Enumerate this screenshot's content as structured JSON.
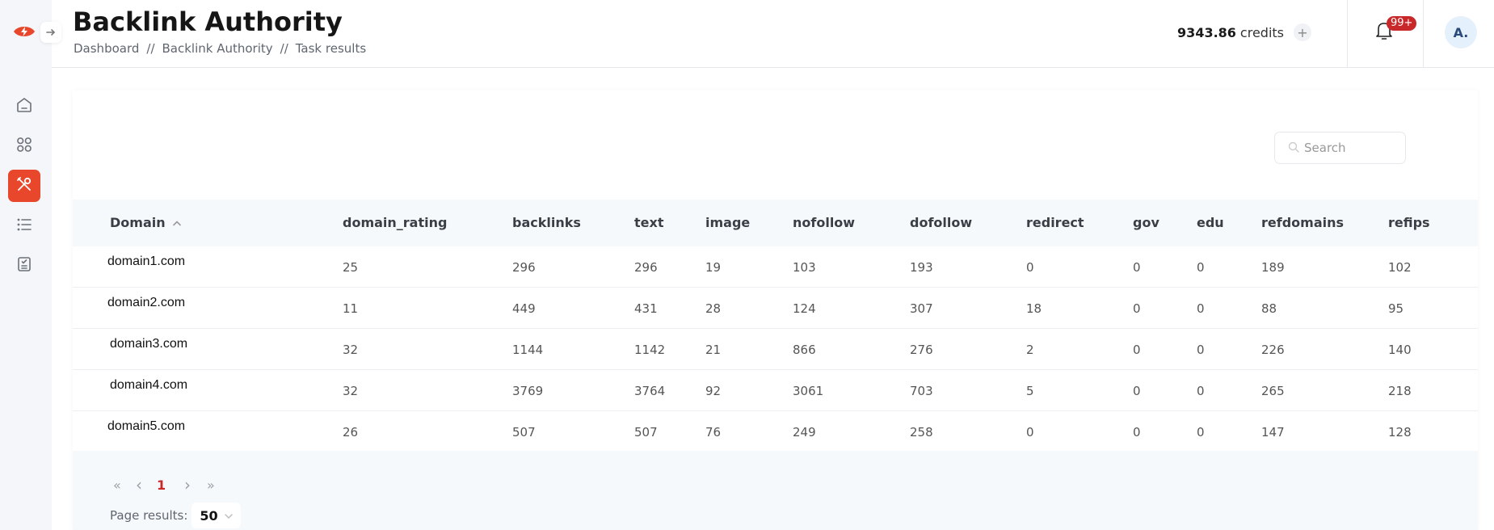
{
  "app": {
    "title": "Backlink Authority",
    "breadcrumb": [
      "Dashboard",
      "Backlink Authority",
      "Task results"
    ],
    "breadcrumb_separator": "//",
    "brand_color": "#e8472b"
  },
  "header": {
    "credits_value": "9343.86",
    "credits_label": "credits",
    "add_credits_label": "+",
    "notifications_badge": "99+",
    "avatar_initials": "A."
  },
  "sidebar": {
    "items": [
      {
        "name": "home",
        "icon": "home-icon",
        "active": false
      },
      {
        "name": "apps",
        "icon": "grid-icon",
        "active": false
      },
      {
        "name": "tools",
        "icon": "tools-icon",
        "active": true
      },
      {
        "name": "list",
        "icon": "list-icon",
        "active": false
      },
      {
        "name": "tasks",
        "icon": "checklist-icon",
        "active": false
      }
    ]
  },
  "search": {
    "placeholder": "Search",
    "value": ""
  },
  "table": {
    "columns": [
      "Domain",
      "domain_rating",
      "backlinks",
      "text",
      "image",
      "nofollow",
      "dofollow",
      "redirect",
      "gov",
      "edu",
      "refdomains",
      "refips"
    ],
    "sort": {
      "column": "Domain",
      "direction": "ascending"
    },
    "rows": [
      [
        "domain1.com",
        "25",
        "296",
        "296",
        "19",
        "103",
        "193",
        "0",
        "0",
        "0",
        "189",
        "102"
      ],
      [
        "domain2.com",
        "11",
        "449",
        "431",
        "28",
        "124",
        "307",
        "18",
        "0",
        "0",
        "88",
        "95"
      ],
      [
        "domain3.com",
        "32",
        "1144",
        "1142",
        "21",
        "866",
        "276",
        "2",
        "0",
        "0",
        "226",
        "140"
      ],
      [
        "domain4.com",
        "32",
        "3769",
        "3764",
        "92",
        "3061",
        "703",
        "5",
        "0",
        "0",
        "265",
        "218"
      ],
      [
        "domain5.com",
        "26",
        "507",
        "507",
        "76",
        "249",
        "258",
        "0",
        "0",
        "0",
        "147",
        "128"
      ]
    ]
  },
  "pagination": {
    "first_label": "«",
    "prev_label": "‹",
    "current_page": "1",
    "next_label": "›",
    "last_label": "»",
    "page_results_label": "Page results:",
    "page_size": "50"
  }
}
